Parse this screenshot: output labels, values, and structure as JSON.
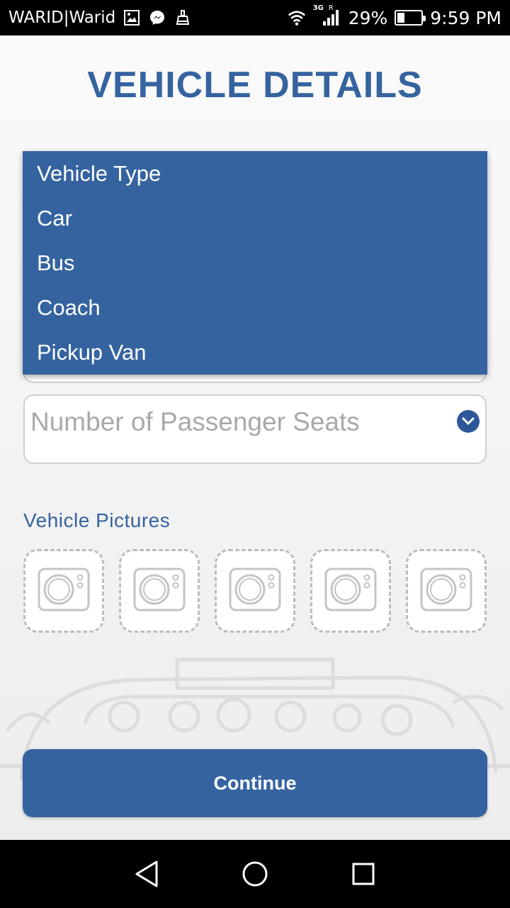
{
  "status_bar": {
    "carrier": "WARID|Warid",
    "network": "3G",
    "roaming": "R",
    "battery_percent": "29%",
    "battery_level": 0.29,
    "time": "9:59 PM",
    "icons": [
      "image-notification-icon",
      "messenger-icon",
      "cleaner-icon",
      "wifi-icon",
      "signal-icon",
      "battery-icon"
    ]
  },
  "page": {
    "title": "VEHICLE DETAILS"
  },
  "dropdown": {
    "items": [
      "Vehicle Type",
      "Car",
      "Bus",
      "Coach",
      "Pickup Van"
    ]
  },
  "seats_field": {
    "placeholder": "Number of Passenger Seats",
    "icon": "chevron-down-icon"
  },
  "pictures": {
    "label": "Vehicle Pictures",
    "slot_count": 5,
    "icon": "camera-icon"
  },
  "actions": {
    "continue_label": "Continue"
  },
  "colors": {
    "accent": "#3563a0",
    "placeholder": "#a9a9a9",
    "border": "#d0d0d0"
  },
  "nav_bar": {
    "icons": [
      "back-icon",
      "home-icon",
      "recents-icon"
    ]
  }
}
